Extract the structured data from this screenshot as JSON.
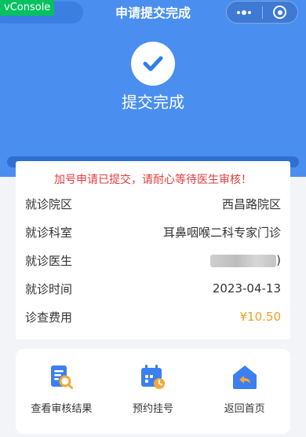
{
  "header": {
    "vconsole_label": "vConsole",
    "title": "申请提交完成"
  },
  "hero": {
    "status_text": "提交完成",
    "status_icon": "check-icon"
  },
  "details": {
    "notice": "加号申请已提交，请耐心等待医生审核！",
    "rows": [
      {
        "label": "就诊院区",
        "value": "西昌路院区"
      },
      {
        "label": "就诊科室",
        "value": "耳鼻咽喉二科专家门诊"
      },
      {
        "label": "就诊医生",
        "value": ")"
      },
      {
        "label": "就诊时间",
        "value": "2023-04-13"
      },
      {
        "label": "诊查费用",
        "value": "¥10.50"
      }
    ]
  },
  "actions": [
    {
      "label": "查看审核结果",
      "icon": "audit-search-icon"
    },
    {
      "label": "预约挂号",
      "icon": "calendar-appointment-icon"
    },
    {
      "label": "返回首页",
      "icon": "home-return-icon"
    }
  ],
  "colors": {
    "brand": "#4a8ff0",
    "notice": "#e03c3c",
    "fee": "#f0a020"
  }
}
